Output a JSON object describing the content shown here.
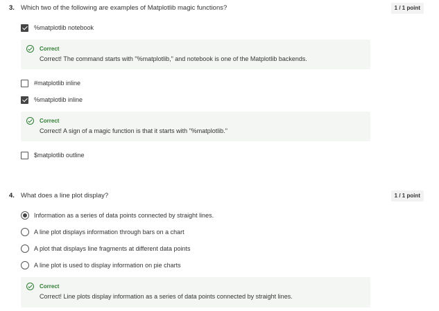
{
  "questions": [
    {
      "number": "3.",
      "text": "Which two of the following are examples of Matplotlib magic functions?",
      "points": "1 / 1 point",
      "options": [
        {
          "label": "%matplotlib notebook",
          "checked": true
        },
        {
          "label": "#matplotlib inline",
          "checked": false
        },
        {
          "label": "%matplotlib inline",
          "checked": true
        },
        {
          "label": "$matplotlib outline",
          "checked": false
        }
      ],
      "feedback": [
        {
          "title": "Correct",
          "text": "Correct! The command starts with \"%matplotlib,\" and notebook is one of the Matplotlib backends."
        },
        {
          "title": "Correct",
          "text": "Correct! A sign of a magic function is that it starts with \"%matplotlib.\""
        }
      ]
    },
    {
      "number": "4.",
      "text": "What does a line plot display?",
      "points": "1 / 1 point",
      "options": [
        {
          "label": "Information as a series of data points connected by straight lines.",
          "checked": true
        },
        {
          "label": "A line plot displays information through bars on a chart",
          "checked": false
        },
        {
          "label": "A plot that displays line fragments at different data points",
          "checked": false
        },
        {
          "label": "A line plot is used to display information on pie charts",
          "checked": false
        }
      ],
      "feedback": [
        {
          "title": "Correct",
          "text": "Correct! Line plots display information as a series of data points connected by straight lines."
        }
      ]
    }
  ],
  "colors": {
    "correct": "#2e7d32",
    "feedback_bg": "#f4f6f4",
    "checked": "#454545"
  },
  "icons": {
    "correct": "check-circle-icon",
    "checkbox": "checkbox-icon",
    "radio": "radio-icon"
  }
}
